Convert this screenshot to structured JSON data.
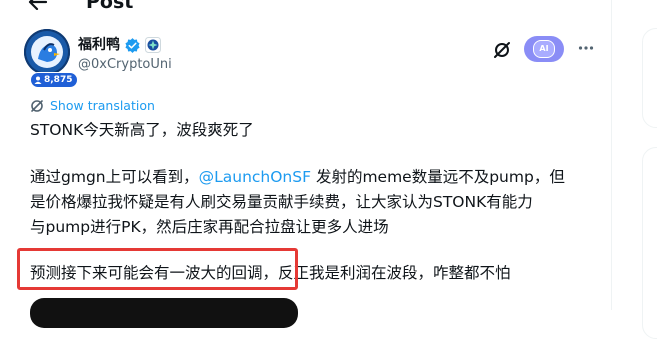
{
  "header": {
    "title": "Post"
  },
  "author": {
    "display_name": "福利鸭",
    "handle": "@0xCryptoUni",
    "follower_badge": "8,875"
  },
  "actions": {
    "ai_label": "AI"
  },
  "tweet": {
    "translate_label": "Show translation",
    "line1": "STONK今天新高了，波段爽死了",
    "line2_prefix": "通过gmgn上可以看到，",
    "line2_mention": "@LaunchOnSF",
    "line2_suffix": " 发射的meme数量远不及pump，但",
    "line3": "是价格爆拉我怀疑是有人刷交易量贡献手续费，让大家认为STONK有能力",
    "line4": "与pump进行PK，然后庄家再配合拉盘让更多人进场",
    "line5_highlighted": "预测接下来可能会有一波大的回调，",
    "line5_rest": "反正我是利润在波段，咋整都不怕"
  },
  "colors": {
    "accent": "#1d9bf0",
    "highlight": "#e53935",
    "verified": "#1d9bf0",
    "ai_button": "#8a8df6"
  }
}
